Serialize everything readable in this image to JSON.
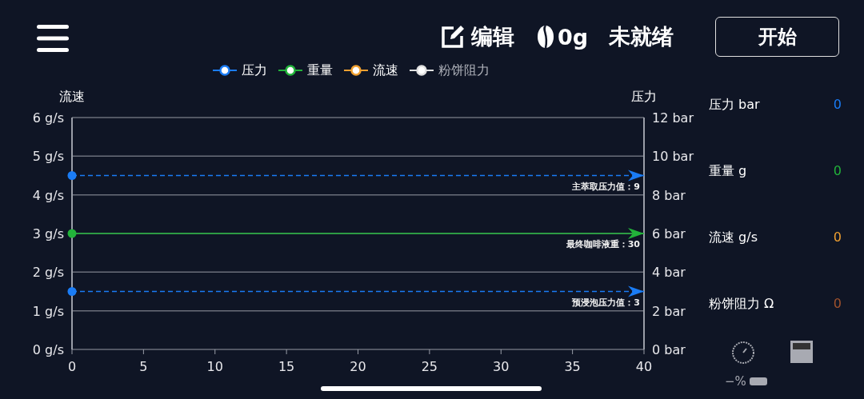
{
  "header": {
    "edit_label": "编辑",
    "weight": "0g",
    "status": "未就绪",
    "start_button": "开始"
  },
  "legend": [
    {
      "name": "压力",
      "color": "#1a7cf5"
    },
    {
      "name": "重量",
      "color": "#22b33a"
    },
    {
      "name": "流速",
      "color": "#f0a030"
    },
    {
      "name": "粉饼阻力",
      "color": "#e0e0e0"
    }
  ],
  "left_axis_title": "流速",
  "right_axis_title": "压力",
  "right_ticks": [
    "12 bar",
    "10 bar",
    "8 bar",
    "6 bar",
    "4 bar",
    "2 bar",
    "0 bar"
  ],
  "chart_data": {
    "type": "line",
    "grid": true,
    "xlim": [
      0,
      40
    ],
    "ylim": [
      0,
      6
    ],
    "xticks": [
      0,
      5,
      10,
      15,
      20,
      25,
      30,
      35,
      40
    ],
    "yticks": [
      {
        "value": 0,
        "label": "0 g/s"
      },
      {
        "value": 1,
        "label": "1 g/s"
      },
      {
        "value": 2,
        "label": "2 g/s"
      },
      {
        "value": 3,
        "label": "3 g/s"
      },
      {
        "value": 4,
        "label": "4 g/s"
      },
      {
        "value": 5,
        "label": "5 g/s"
      },
      {
        "value": 6,
        "label": "6 g/s"
      }
    ],
    "x": [
      0,
      40
    ],
    "series": [
      {
        "color": "#1a7cf5",
        "values": [
          4.5,
          4.5
        ],
        "line_style": "dashed"
      },
      {
        "color": "#22b33a",
        "values": [
          3,
          3
        ],
        "line_style": "solid"
      },
      {
        "color": "#1a7cf5",
        "values": [
          1.5,
          1.5
        ],
        "line_style": "dashed"
      }
    ],
    "annotations": [
      {
        "text": "主萃取压力值：9",
        "y": 4.5
      },
      {
        "text": "最终咖啡液重：30",
        "y": 3
      },
      {
        "text": "预浸泡压力值：3",
        "y": 1.5
      }
    ]
  },
  "readings": [
    {
      "label": "压力 bar",
      "value": "0",
      "color": "#1a7cf5"
    },
    {
      "label": "重量 g",
      "value": "0",
      "color": "#22b33a"
    },
    {
      "label": "流速 g/s",
      "value": "0",
      "color": "#f0a030"
    },
    {
      "label": "粉饼阻力 Ω",
      "value": "0",
      "color": "#a0522d"
    }
  ],
  "battery_text": "−%"
}
